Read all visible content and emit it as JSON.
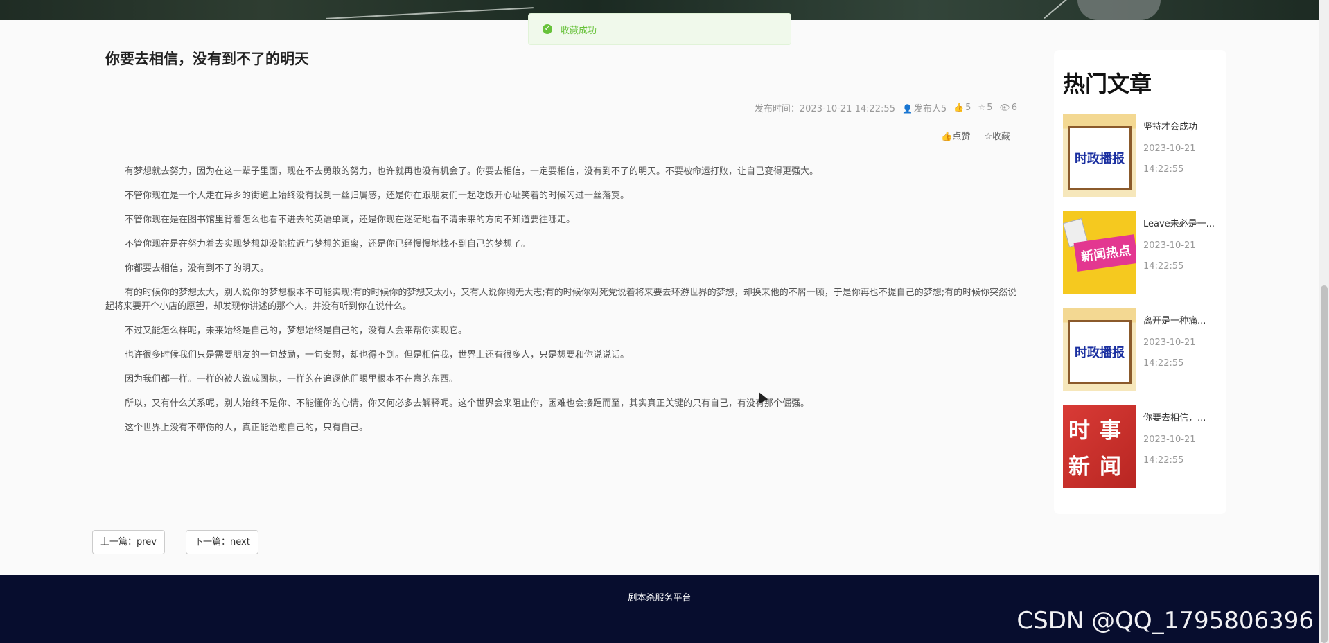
{
  "toast": {
    "message": "收藏成功"
  },
  "article": {
    "title": "你要去相信，没有到不了的明天",
    "meta": {
      "published_label": "发布时间：2023-10-21 14:22:55",
      "author": "发布人5",
      "likes": "5",
      "favorites": "5",
      "views": "6"
    },
    "actions": {
      "like": "点赞",
      "favorite": "收藏"
    },
    "paragraphs": [
      "有梦想就去努力，因为在这一辈子里面，现在不去勇敢的努力，也许就再也没有机会了。你要去相信，一定要相信，没有到不了的明天。不要被命运打败，让自己变得更强大。",
      "不管你现在是一个人走在异乡的街道上始终没有找到一丝归属感，还是你在跟朋友们一起吃饭开心址笑着的时候闪过一丝落寞。",
      "不管你现在是在图书馆里背着怎么也看不进去的英语单词，还是你现在迷茫地看不清未来的方向不知道要往哪走。",
      "不管你现在是在努力着去实现梦想却没能拉近与梦想的距离，还是你已经慢慢地找不到自己的梦想了。",
      "你都要去相信，没有到不了的明天。",
      "有的时候你的梦想太大，别人说你的梦想根本不可能实现;有的时候你的梦想又太小，又有人说你胸无大志;有的时候你对死党说着将来要去环游世界的梦想，却换来他的不屑一顾，于是你再也不提自己的梦想;有的时候你突然说起将来要开个小店的愿望，却发现你讲述的那个人，并没有听到你在说什么。",
      "不过又能怎么样呢，未来始终是自己的，梦想始终是自己的，没有人会来帮你实现它。",
      "也许很多时候我们只是需要朋友的一句鼓励，一句安慰，却也得不到。但是相信我，世界上还有很多人，只是想要和你说说话。",
      "因为我们都一样。一样的被人说成固执，一样的在追逐他们眼里根本不在意的东西。",
      "所以，又有什么关系呢，别人始终不是你、不能懂你的心情，你又何必多去解释呢。这个世界会来阻止你，困难也会接踵而至，其实真正关键的只有自己，有没有那个倔强。",
      "这个世界上没有不带伤的人，真正能治愈自己的，只有自己。"
    ]
  },
  "pager": {
    "prev": "上一篇：prev",
    "next": "下一篇：next"
  },
  "sidebar": {
    "title": "热门文章",
    "items": [
      {
        "name": "坚持才会成功",
        "date": "2023-10-21",
        "time": "14:22:55",
        "thumb_text": "时政播报"
      },
      {
        "name": "Leave未必是一...",
        "date": "2023-10-21",
        "time": "14:22:55",
        "thumb_text": "新闻热点"
      },
      {
        "name": "离开是一种痛...",
        "date": "2023-10-21",
        "time": "14:22:55",
        "thumb_text": "时政播报"
      },
      {
        "name": "你要去相信，...",
        "date": "2023-10-21",
        "time": "14:22:55",
        "thumb_line1": "时事",
        "thumb_line2": "新闻"
      }
    ]
  },
  "footer": {
    "text": "剧本杀服务平台"
  },
  "watermark": "CSDN @QQ_1795806396",
  "colors": {
    "footer_bg": "#070d2e",
    "toast_green": "#67c23a",
    "page_bg": "#fafafa"
  }
}
